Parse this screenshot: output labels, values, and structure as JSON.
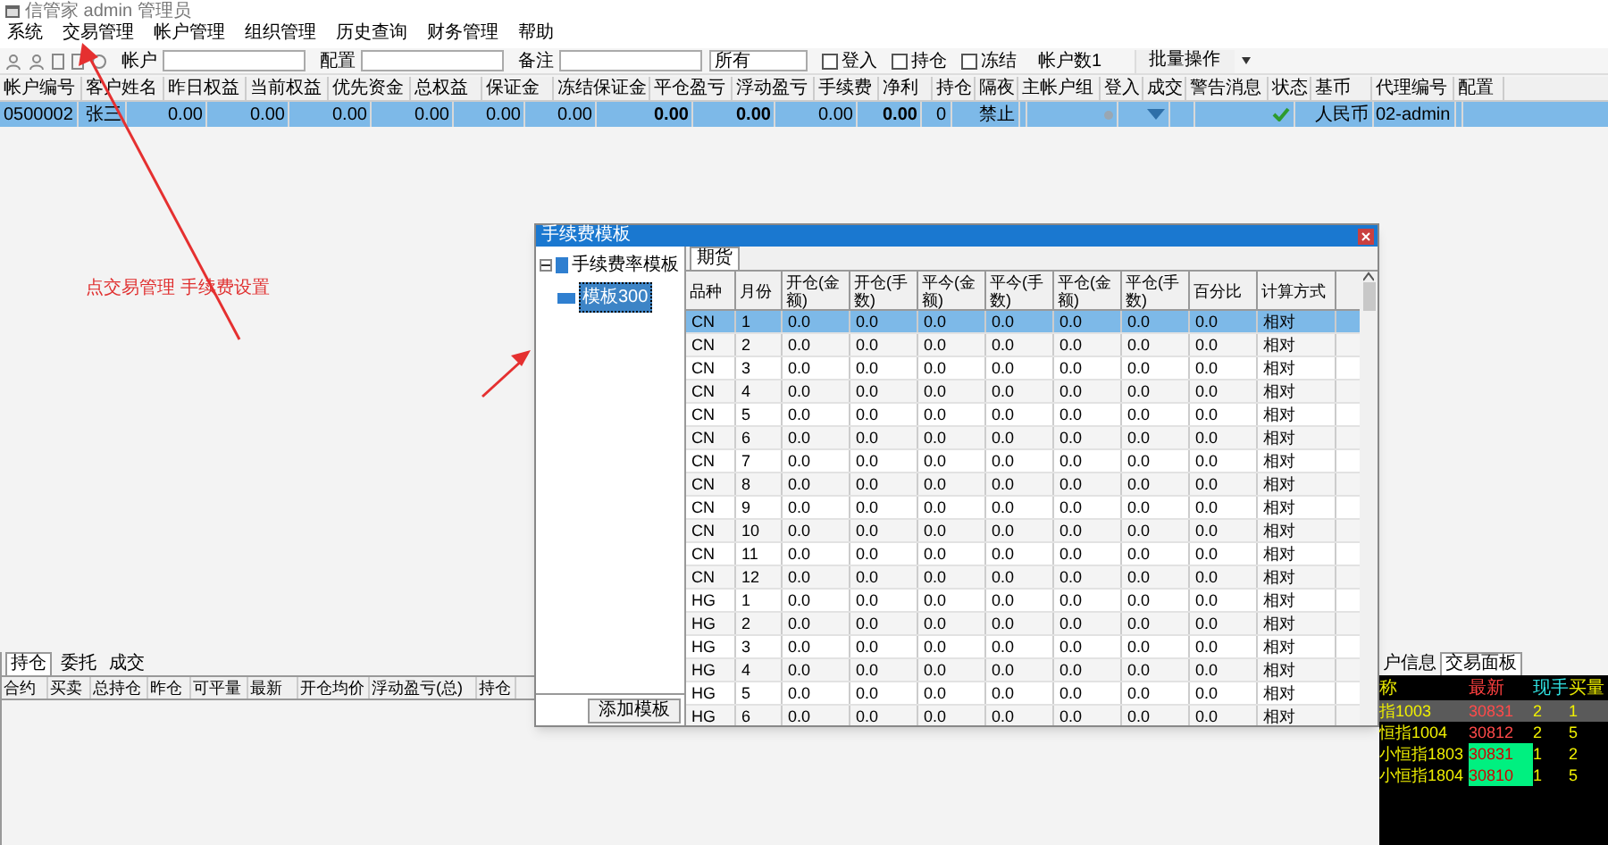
{
  "window": {
    "title": "信管家 admin 管理员"
  },
  "menu": [
    "系统",
    "交易管理",
    "帐户管理",
    "组织管理",
    "历史查询",
    "财务管理",
    "帮助"
  ],
  "toolbar": {
    "fields": [
      {
        "label": "帐户"
      },
      {
        "label": "配置"
      },
      {
        "label": "备注"
      }
    ],
    "filter": {
      "value": "所有"
    },
    "checkboxes": [
      {
        "label": "登入",
        "checked": false
      },
      {
        "label": "持仓",
        "checked": false
      },
      {
        "label": "冻结",
        "checked": false
      }
    ],
    "account_count": "帐户数1",
    "batch_button": "批量操作"
  },
  "accounts": {
    "columns": [
      "帐户编号",
      "客户姓名",
      "昨日权益",
      "当前权益",
      "优先资金",
      "总权益",
      "保证金",
      "冻结保证金",
      "平仓盈亏",
      "浮动盈亏",
      "手续费",
      "净利",
      "持仓",
      "隔夜",
      "主帐户组",
      "登入",
      "成交",
      "警告消息",
      "状态",
      "基币",
      "代理编号",
      "配置"
    ],
    "rows": [
      {
        "selected": true,
        "cells": [
          {
            "kind": "text",
            "text": "0500002",
            "bold": false
          },
          {
            "kind": "text",
            "text": "张三",
            "bold": false
          },
          {
            "kind": "text",
            "text": "0.00",
            "bold": false
          },
          {
            "kind": "text",
            "text": "0.00",
            "bold": false
          },
          {
            "kind": "text",
            "text": "0.00",
            "bold": false
          },
          {
            "kind": "text",
            "text": "0.00",
            "bold": false
          },
          {
            "kind": "text",
            "text": "0.00",
            "bold": false
          },
          {
            "kind": "text",
            "text": "0.00",
            "bold": false
          },
          {
            "kind": "text",
            "text": "0.00",
            "bold": true
          },
          {
            "kind": "text",
            "text": "0.00",
            "bold": true
          },
          {
            "kind": "text",
            "text": "0.00",
            "bold": false
          },
          {
            "kind": "text",
            "text": "0.00",
            "bold": true
          },
          {
            "kind": "text",
            "text": "0",
            "bold": false
          },
          {
            "kind": "text",
            "text": "禁止",
            "bold": false
          },
          {
            "kind": "empty"
          },
          {
            "kind": "dot"
          },
          {
            "kind": "funnel"
          },
          {
            "kind": "empty"
          },
          {
            "kind": "check"
          },
          {
            "kind": "text",
            "text": "人民币",
            "bold": false
          },
          {
            "kind": "text",
            "text": "02-admin",
            "bold": false
          },
          {
            "kind": "empty"
          }
        ]
      }
    ]
  },
  "annotation": {
    "text": "点交易管理 手续费设置"
  },
  "positions": {
    "tabs": [
      {
        "label": "持仓",
        "selected": true
      },
      {
        "label": "委托",
        "selected": false
      },
      {
        "label": "成交",
        "selected": false
      }
    ],
    "columns": [
      "合约",
      "买卖",
      "总持仓",
      "昨仓",
      "可平量",
      "最新",
      "开仓均价",
      "浮动盈亏(总)",
      "持仓"
    ]
  },
  "quotes": {
    "tabs": [
      {
        "label": "户信息",
        "selected": false
      },
      {
        "label": "交易面板",
        "selected": true
      }
    ],
    "columns": [
      "称",
      "最新",
      "现手",
      "买量"
    ],
    "rows": [
      {
        "cells": [
          "指1003",
          "30831",
          "2",
          "1"
        ],
        "selected": true,
        "highlight": false
      },
      {
        "cells": [
          "恒指1004",
          "30812",
          "2",
          "5"
        ],
        "selected": false,
        "highlight": false
      },
      {
        "cells": [
          "小恒指1803",
          "30831",
          "1",
          "2"
        ],
        "selected": false,
        "highlight": true
      },
      {
        "cells": [
          "小恒指1804",
          "30810",
          "1",
          "5"
        ],
        "selected": false,
        "highlight": true
      }
    ]
  },
  "dialog": {
    "title": "手续费模板",
    "tree": {
      "label": "手续费率模板",
      "expanded": true,
      "children": [
        {
          "label": "模板300",
          "selected": true
        }
      ]
    },
    "tabs": [
      {
        "label": "期货",
        "selected": true
      }
    ],
    "columns": [
      "品种",
      "月份",
      "开仓(金额)",
      "开仓(手数)",
      "平今(金额)",
      "平今(手数)",
      "平仓(金额)",
      "平仓(手数)",
      "百分比",
      "计算方式"
    ],
    "rows": [
      {
        "cells": [
          "CN",
          "1",
          "0.0",
          "0.0",
          "0.0",
          "0.0",
          "0.0",
          "0.0",
          "0.0",
          "相对"
        ],
        "selected": true
      },
      {
        "cells": [
          "CN",
          "2",
          "0.0",
          "0.0",
          "0.0",
          "0.0",
          "0.0",
          "0.0",
          "0.0",
          "相对"
        ],
        "selected": false
      },
      {
        "cells": [
          "CN",
          "3",
          "0.0",
          "0.0",
          "0.0",
          "0.0",
          "0.0",
          "0.0",
          "0.0",
          "相对"
        ],
        "selected": false
      },
      {
        "cells": [
          "CN",
          "4",
          "0.0",
          "0.0",
          "0.0",
          "0.0",
          "0.0",
          "0.0",
          "0.0",
          "相对"
        ],
        "selected": false
      },
      {
        "cells": [
          "CN",
          "5",
          "0.0",
          "0.0",
          "0.0",
          "0.0",
          "0.0",
          "0.0",
          "0.0",
          "相对"
        ],
        "selected": false
      },
      {
        "cells": [
          "CN",
          "6",
          "0.0",
          "0.0",
          "0.0",
          "0.0",
          "0.0",
          "0.0",
          "0.0",
          "相对"
        ],
        "selected": false
      },
      {
        "cells": [
          "CN",
          "7",
          "0.0",
          "0.0",
          "0.0",
          "0.0",
          "0.0",
          "0.0",
          "0.0",
          "相对"
        ],
        "selected": false
      },
      {
        "cells": [
          "CN",
          "8",
          "0.0",
          "0.0",
          "0.0",
          "0.0",
          "0.0",
          "0.0",
          "0.0",
          "相对"
        ],
        "selected": false
      },
      {
        "cells": [
          "CN",
          "9",
          "0.0",
          "0.0",
          "0.0",
          "0.0",
          "0.0",
          "0.0",
          "0.0",
          "相对"
        ],
        "selected": false
      },
      {
        "cells": [
          "CN",
          "10",
          "0.0",
          "0.0",
          "0.0",
          "0.0",
          "0.0",
          "0.0",
          "0.0",
          "相对"
        ],
        "selected": false
      },
      {
        "cells": [
          "CN",
          "11",
          "0.0",
          "0.0",
          "0.0",
          "0.0",
          "0.0",
          "0.0",
          "0.0",
          "相对"
        ],
        "selected": false
      },
      {
        "cells": [
          "CN",
          "12",
          "0.0",
          "0.0",
          "0.0",
          "0.0",
          "0.0",
          "0.0",
          "0.0",
          "相对"
        ],
        "selected": false
      },
      {
        "cells": [
          "HG",
          "1",
          "0.0",
          "0.0",
          "0.0",
          "0.0",
          "0.0",
          "0.0",
          "0.0",
          "相对"
        ],
        "selected": false
      },
      {
        "cells": [
          "HG",
          "2",
          "0.0",
          "0.0",
          "0.0",
          "0.0",
          "0.0",
          "0.0",
          "0.0",
          "相对"
        ],
        "selected": false
      },
      {
        "cells": [
          "HG",
          "3",
          "0.0",
          "0.0",
          "0.0",
          "0.0",
          "0.0",
          "0.0",
          "0.0",
          "相对"
        ],
        "selected": false
      },
      {
        "cells": [
          "HG",
          "4",
          "0.0",
          "0.0",
          "0.0",
          "0.0",
          "0.0",
          "0.0",
          "0.0",
          "相对"
        ],
        "selected": false
      },
      {
        "cells": [
          "HG",
          "5",
          "0.0",
          "0.0",
          "0.0",
          "0.0",
          "0.0",
          "0.0",
          "0.0",
          "相对"
        ],
        "selected": false
      },
      {
        "cells": [
          "HG",
          "6",
          "0.0",
          "0.0",
          "0.0",
          "0.0",
          "0.0",
          "0.0",
          "0.0",
          "相对"
        ],
        "selected": false
      }
    ],
    "button": "添加模板"
  }
}
